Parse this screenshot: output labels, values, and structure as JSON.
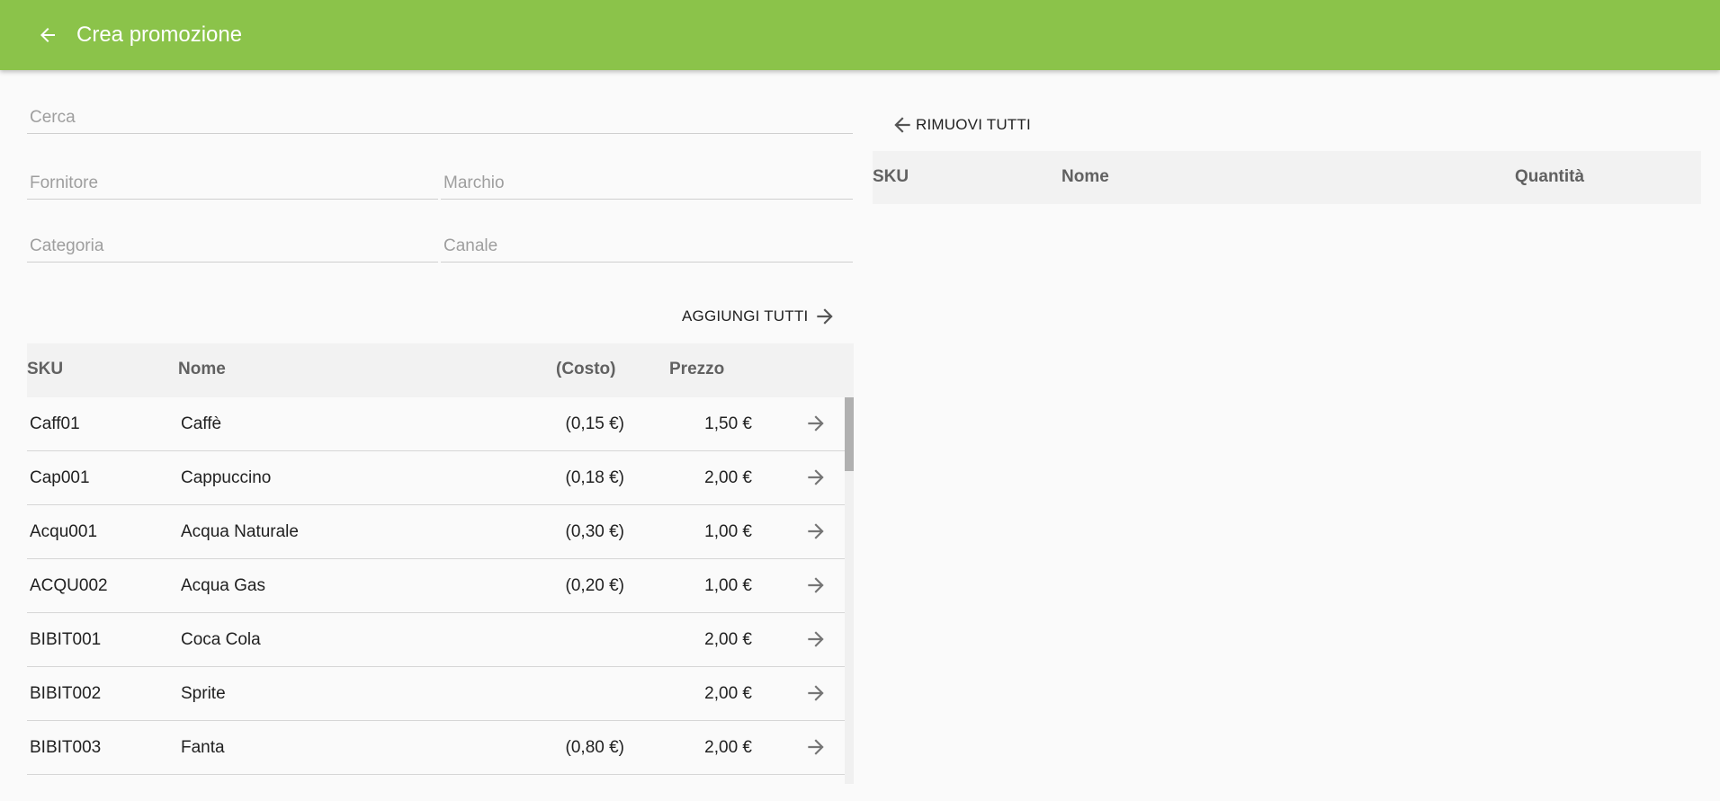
{
  "appbar": {
    "title": "Crea promozione",
    "back_icon": "arrow-back-icon",
    "color": "#8bc34a"
  },
  "filters": {
    "search_placeholder": "Cerca",
    "supplier_placeholder": "Fornitore",
    "brand_placeholder": "Marchio",
    "category_placeholder": "Categoria",
    "channel_placeholder": "Canale"
  },
  "left": {
    "add_all_label": "AGGIUNGI TUTTI",
    "columns": {
      "sku": "SKU",
      "name": "Nome",
      "cost": "(Costo)",
      "price": "Prezzo"
    },
    "rows": [
      {
        "sku": "Caff01",
        "name": "Caffè",
        "cost": "(0,15 €)",
        "price": "1,50 €"
      },
      {
        "sku": "Cap001",
        "name": "Cappuccino",
        "cost": "(0,18 €)",
        "price": "2,00 €"
      },
      {
        "sku": "Acqu001",
        "name": "Acqua Naturale",
        "cost": "(0,30 €)",
        "price": "1,00 €"
      },
      {
        "sku": "ACQU002",
        "name": "Acqua Gas",
        "cost": "(0,20 €)",
        "price": "1,00 €"
      },
      {
        "sku": "BIBIT001",
        "name": "Coca Cola",
        "cost": "",
        "price": "2,00 €"
      },
      {
        "sku": "BIBIT002",
        "name": "Sprite",
        "cost": "",
        "price": "2,00 €"
      },
      {
        "sku": "BIBIT003",
        "name": "Fanta",
        "cost": "(0,80 €)",
        "price": "2,00 €"
      }
    ]
  },
  "right": {
    "remove_all_label": "RIMUOVI TUTTI",
    "columns": {
      "sku": "SKU",
      "name": "Nome",
      "quantity": "Quantità"
    }
  }
}
